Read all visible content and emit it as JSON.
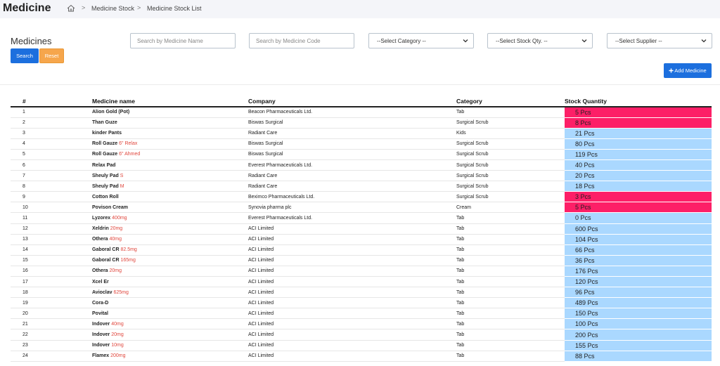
{
  "header": {
    "title": "Medicine",
    "breadcrumb": [
      "Medicine Stock",
      "Medicine Stock List"
    ]
  },
  "section_title": "Medicines",
  "filters": {
    "name_placeholder": "Search by Medicine Name",
    "code_placeholder": "Search by Medicine Code",
    "category": "--Select Category --",
    "stock_qty": "--Select Stock Qty. --",
    "supplier": "--Select Supplier --"
  },
  "buttons": {
    "search": "Search",
    "reset": "Reset",
    "add": "Add Medicine"
  },
  "table": {
    "columns": [
      "#",
      "Medicine name",
      "Company",
      "Category",
      "Stock Quantity"
    ],
    "rows": [
      {
        "no": "1",
        "name": "Alion Gold (Pot)",
        "strength": "",
        "company": "Beacon Pharmaceuticals Ltd.",
        "category": "Tab",
        "qty": "5 Pcs",
        "status": "low"
      },
      {
        "no": "2",
        "name": "Than Guze",
        "strength": "",
        "company": "Biswas Surgical",
        "category": "Surgical Scrub",
        "qty": "8 Pcs",
        "status": "low"
      },
      {
        "no": "3",
        "name": "kinder Pants",
        "strength": "",
        "company": "Radiant Care",
        "category": "Kids",
        "qty": "21 Pcs",
        "status": "ok"
      },
      {
        "no": "4",
        "name": "Roll Gauze",
        "strength": "6\" Relax",
        "company": "Biswas Surgical",
        "category": "Surgical Scrub",
        "qty": "80 Pcs",
        "status": "ok"
      },
      {
        "no": "5",
        "name": "Roll Gauze",
        "strength": "6\" Ahmed",
        "company": "Biswas Surgical",
        "category": "Surgical Scrub",
        "qty": "119 Pcs",
        "status": "ok"
      },
      {
        "no": "6",
        "name": "Relax Pad",
        "strength": "",
        "company": "Everest Pharmaceuticals Ltd.",
        "category": "Surgical Scrub",
        "qty": "40 Pcs",
        "status": "ok"
      },
      {
        "no": "7",
        "name": "Sheuly Pad",
        "strength": "S",
        "company": "Radiant Care",
        "category": "Surgical Scrub",
        "qty": "20 Pcs",
        "status": "ok"
      },
      {
        "no": "8",
        "name": "Sheuly Pad",
        "strength": "M",
        "company": "Radiant Care",
        "category": "Surgical Scrub",
        "qty": "18 Pcs",
        "status": "ok"
      },
      {
        "no": "9",
        "name": "Cotton Roll",
        "strength": "",
        "company": "Beximco Pharmaceuticals Ltd.",
        "category": "Surgical Scrub",
        "qty": "3 Pcs",
        "status": "low"
      },
      {
        "no": "10",
        "name": "Povison Cream",
        "strength": "",
        "company": "Synovia pharma plc",
        "category": "Cream",
        "qty": "5 Pcs",
        "status": "low"
      },
      {
        "no": "11",
        "name": "Lyzorex",
        "strength": "400mg",
        "company": "Everest Pharmaceuticals Ltd.",
        "category": "Tab",
        "qty": "0 Pcs",
        "status": "ok"
      },
      {
        "no": "12",
        "name": "Xeldrin",
        "strength": "20mg",
        "company": "ACI Limited",
        "category": "Tab",
        "qty": "600 Pcs",
        "status": "ok"
      },
      {
        "no": "13",
        "name": "Othera",
        "strength": "40mg",
        "company": "ACI Limited",
        "category": "Tab",
        "qty": "104 Pcs",
        "status": "ok"
      },
      {
        "no": "14",
        "name": "Gaboral CR",
        "strength": "82.5mg",
        "company": "ACI Limited",
        "category": "Tab",
        "qty": "66 Pcs",
        "status": "ok"
      },
      {
        "no": "15",
        "name": "Gaboral CR",
        "strength": "165mg",
        "company": "ACI Limited",
        "category": "Tab",
        "qty": "36 Pcs",
        "status": "ok"
      },
      {
        "no": "16",
        "name": "Othera",
        "strength": "20mg",
        "company": "ACI Limited",
        "category": "Tab",
        "qty": "176 Pcs",
        "status": "ok"
      },
      {
        "no": "17",
        "name": "Xcel Er",
        "strength": "",
        "company": "ACI Limited",
        "category": "Tab",
        "qty": "120 Pcs",
        "status": "ok"
      },
      {
        "no": "18",
        "name": "Avioclav",
        "strength": "625mg",
        "company": "ACI Limited",
        "category": "Tab",
        "qty": "96 Pcs",
        "status": "ok"
      },
      {
        "no": "19",
        "name": "Cora-D",
        "strength": "",
        "company": "ACI Limited",
        "category": "Tab",
        "qty": "489 Pcs",
        "status": "ok"
      },
      {
        "no": "20",
        "name": "Povital",
        "strength": "",
        "company": "ACI Limited",
        "category": "Tab",
        "qty": "150 Pcs",
        "status": "ok"
      },
      {
        "no": "21",
        "name": "Indover",
        "strength": "40mg",
        "company": "ACI Limited",
        "category": "Tab",
        "qty": "100 Pcs",
        "status": "ok"
      },
      {
        "no": "22",
        "name": "Indover",
        "strength": "20mg",
        "company": "ACI Limited",
        "category": "Tab",
        "qty": "200 Pcs",
        "status": "ok"
      },
      {
        "no": "23",
        "name": "Indover",
        "strength": "10mg",
        "company": "ACI Limited",
        "category": "Tab",
        "qty": "155 Pcs",
        "status": "ok"
      },
      {
        "no": "24",
        "name": "Flamex",
        "strength": "200mg",
        "company": "ACI Limited",
        "category": "Tab",
        "qty": "88 Pcs",
        "status": "ok"
      }
    ]
  }
}
